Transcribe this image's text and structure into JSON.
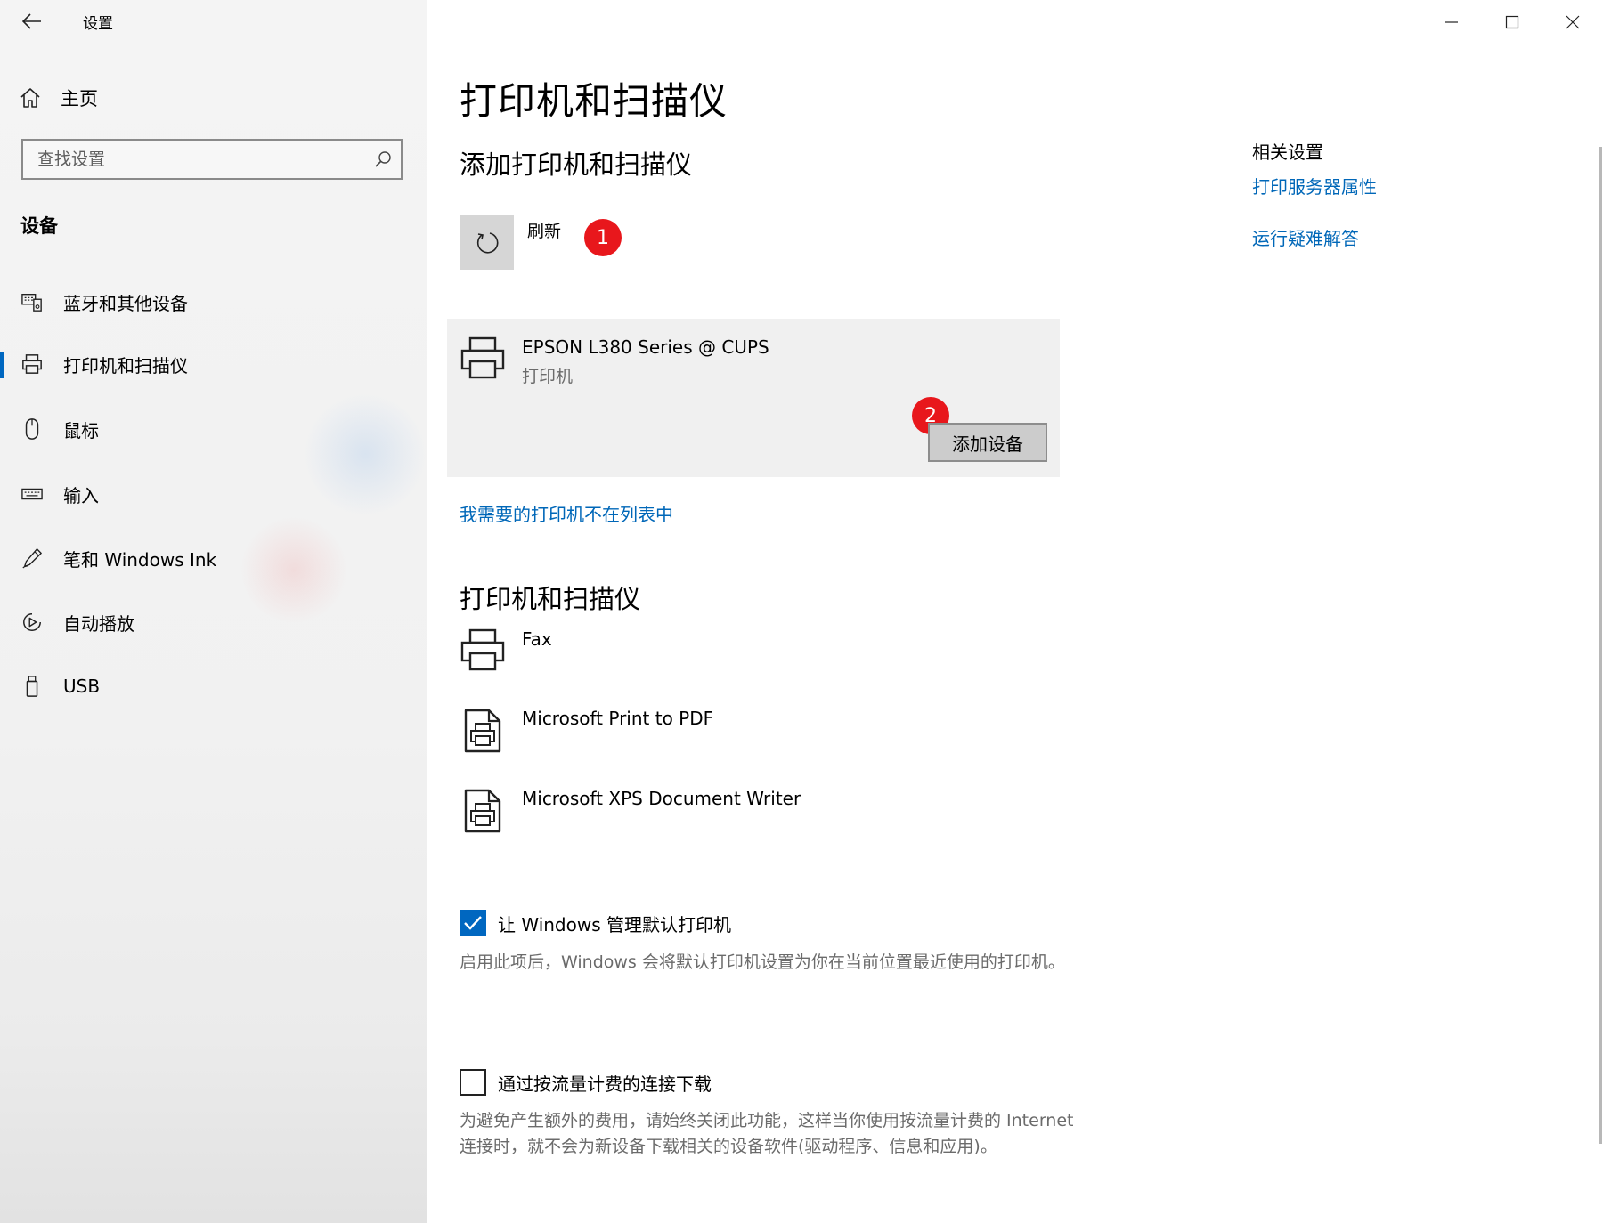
{
  "window": {
    "title": "设置",
    "controls": {
      "minimize": "minimize",
      "maximize": "maximize",
      "close": "close"
    }
  },
  "sidebar": {
    "home_label": "主页",
    "search_placeholder": "查找设置",
    "section_title": "设备",
    "items": [
      {
        "label": "蓝牙和其他设备",
        "icon": "bluetooth-devices-icon",
        "active": false
      },
      {
        "label": "打印机和扫描仪",
        "icon": "printer-icon",
        "active": true
      },
      {
        "label": "鼠标",
        "icon": "mouse-icon",
        "active": false
      },
      {
        "label": "输入",
        "icon": "keyboard-icon",
        "active": false
      },
      {
        "label": "笔和 Windows Ink",
        "icon": "pen-icon",
        "active": false
      },
      {
        "label": "自动播放",
        "icon": "autoplay-icon",
        "active": false
      },
      {
        "label": "USB",
        "icon": "usb-icon",
        "active": false
      }
    ]
  },
  "main": {
    "page_title": "打印机和扫描仪",
    "add_section": {
      "title": "添加打印机和扫描仪",
      "refresh_label": "刷新",
      "badge_1": "1",
      "badge_2": "2",
      "found_device": {
        "name": "EPSON L380 Series @ CUPS",
        "type": "打印机",
        "button": "添加设备"
      },
      "not_listed_link": "我需要的打印机不在列表中"
    },
    "printers_section": {
      "title": "打印机和扫描仪",
      "items": [
        {
          "name": "Fax",
          "icon": "printer-icon"
        },
        {
          "name": "Microsoft Print to PDF",
          "icon": "document-printer-icon"
        },
        {
          "name": "Microsoft XPS Document Writer",
          "icon": "document-printer-icon"
        }
      ]
    },
    "default_printer": {
      "label": "让 Windows 管理默认打印机",
      "checked": true,
      "description": "启用此项后，Windows 会将默认打印机设置为你在当前位置最近使用的打印机。"
    },
    "metered_download": {
      "label": "通过按流量计费的连接下载",
      "checked": false,
      "description": "为避免产生额外的费用，请始终关闭此功能，这样当你使用按流量计费的 Internet 连接时，就不会为新设备下载相关的设备软件(驱动程序、信息和应用)。"
    }
  },
  "related": {
    "title": "相关设置",
    "links": [
      "打印服务器属性",
      "运行疑难解答"
    ]
  },
  "colors": {
    "accent": "#0067c0",
    "link": "#0067b8",
    "badge": "#e8171c",
    "sidebar_bg": "#f2f2f2",
    "card_bg": "#f0f0f0"
  }
}
